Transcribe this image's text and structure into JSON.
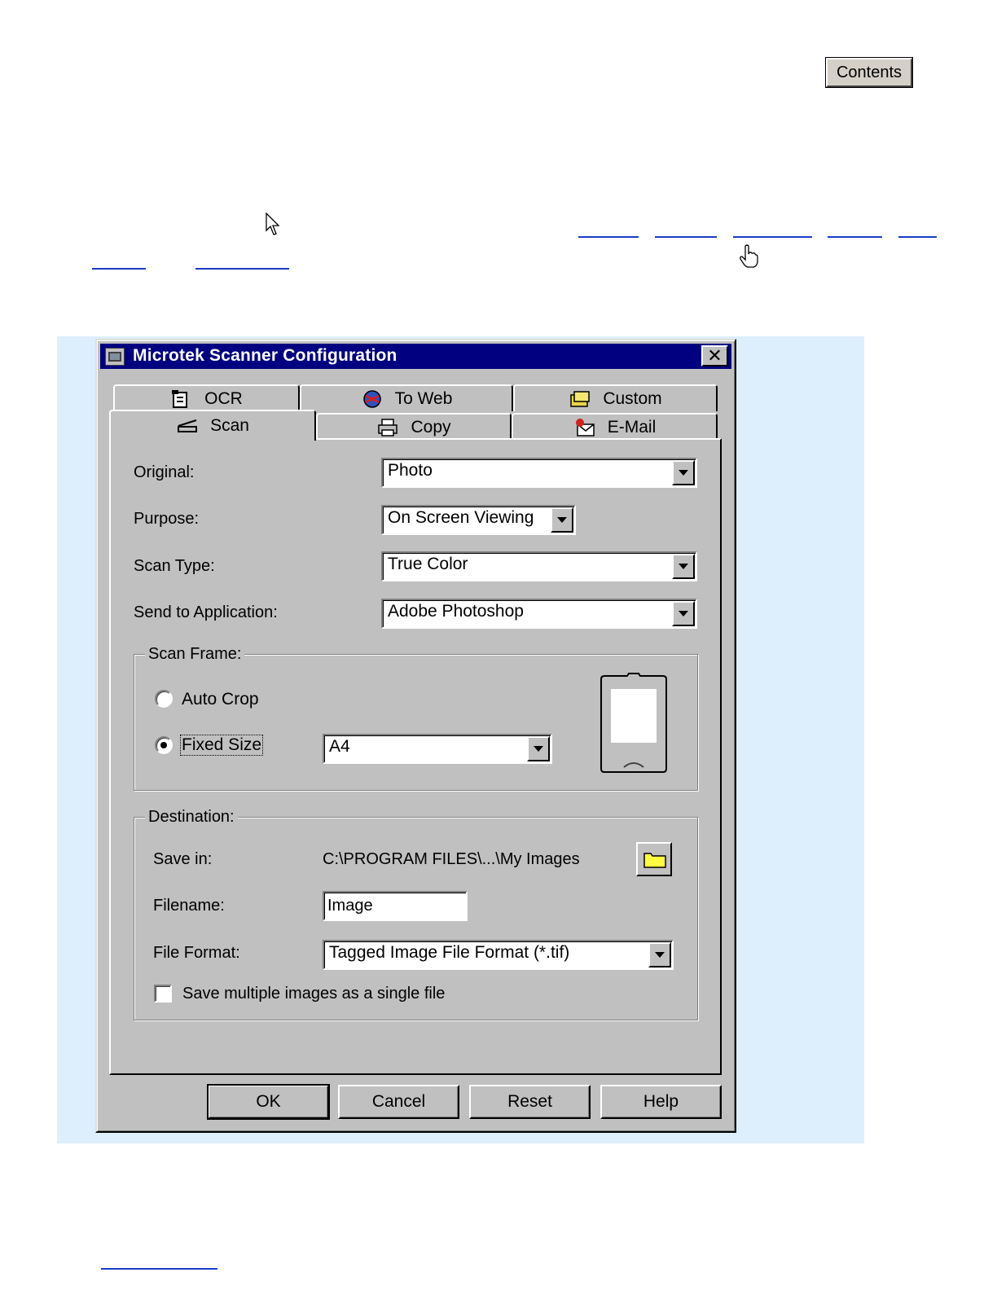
{
  "top_bar": {
    "contents_button": "Contents"
  },
  "dialog": {
    "title": "Microtek Scanner Configuration",
    "close_symbol": "✕",
    "tabs_back": [
      "OCR",
      "To Web",
      "Custom"
    ],
    "tabs_front": [
      "Scan",
      "Copy",
      "E-Mail"
    ],
    "tab_icons": {
      "OCR": "ocr-document-icon",
      "To Web": "globe-icon",
      "Custom": "folders-icon",
      "Scan": "scanner-icon",
      "Copy": "printer-icon",
      "E-Mail": "email-icon"
    },
    "fields": {
      "original_label": "Original:",
      "original_value": "Photo",
      "purpose_label": "Purpose:",
      "purpose_value": "On Screen Viewing",
      "scan_type_label": "Scan Type:",
      "scan_type_value": "True Color",
      "send_to_label": "Send to Application:",
      "send_to_value": "Adobe Photoshop"
    },
    "scan_frame": {
      "legend": "Scan Frame:",
      "auto_crop": "Auto Crop",
      "fixed_size": "Fixed Size",
      "size_value": "A4",
      "selected": "Fixed Size"
    },
    "destination": {
      "legend": "Destination:",
      "save_in_label": "Save in:",
      "save_in_path": "C:\\PROGRAM FILES\\...\\My Images",
      "filename_label": "Filename:",
      "filename_value": "Image",
      "format_label": "File Format:",
      "format_value": "Tagged Image File Format (*.tif)",
      "multi_label": "Save multiple images as a single file",
      "multi_checked": false
    },
    "buttons": {
      "ok": "OK",
      "cancel": "Cancel",
      "reset": "Reset",
      "help": "Help"
    }
  },
  "colors": {
    "titlebar": "#000080",
    "face": "#c0c0c0",
    "panel_bg": "#ddeefd",
    "link": "#1a3cc8"
  }
}
